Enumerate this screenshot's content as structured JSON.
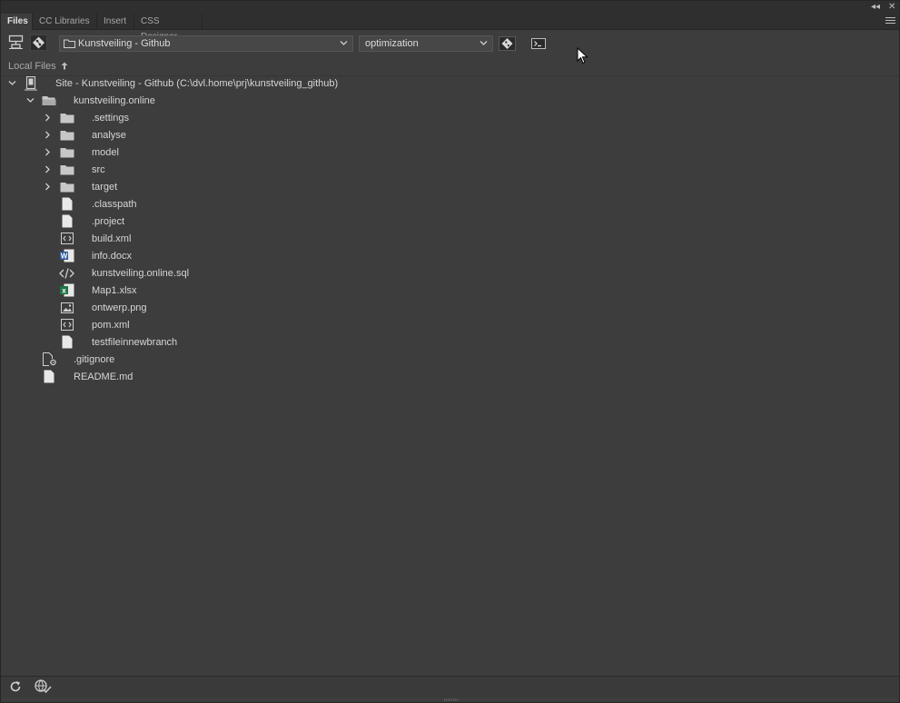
{
  "tabs": [
    {
      "label": "Files",
      "active": true
    },
    {
      "label": "CC Libraries",
      "active": false
    },
    {
      "label": "Insert",
      "active": false
    },
    {
      "label": "CSS Designer",
      "active": false
    }
  ],
  "toolbar": {
    "site_select_value": "Kunstveiling - Github",
    "branch_select_value": "optimization"
  },
  "local_files_label": "Local Files",
  "tree": {
    "site_root": "Site - Kunstveiling - Github (C:\\dvl.home\\prj\\kunstveiling_github)",
    "project_folder": "kunstveiling.online",
    "folders": [
      ".settings",
      "analyse",
      "model",
      "src",
      "target"
    ],
    "files": [
      {
        "name": ".classpath",
        "icon": "file-icon"
      },
      {
        "name": ".project",
        "icon": "file-icon"
      },
      {
        "name": "build.xml",
        "icon": "xml-file-icon"
      },
      {
        "name": "info.docx",
        "icon": "word-file-icon"
      },
      {
        "name": "kunstveiling.online.sql",
        "icon": "code-file-icon"
      },
      {
        "name": "Map1.xlsx",
        "icon": "excel-file-icon"
      },
      {
        "name": "ontwerp.png",
        "icon": "image-file-icon"
      },
      {
        "name": "pom.xml",
        "icon": "xml-file-icon"
      },
      {
        "name": "testfileinnewbranch",
        "icon": "file-icon"
      }
    ],
    "root_files": [
      {
        "name": ".gitignore",
        "icon": "settings-file-icon"
      },
      {
        "name": "README.md",
        "icon": "file-icon"
      }
    ]
  },
  "colors": {
    "panel_bg": "#3d3d3d",
    "tab_bar_bg": "#2f2f2f",
    "text": "#d6d6d6"
  }
}
